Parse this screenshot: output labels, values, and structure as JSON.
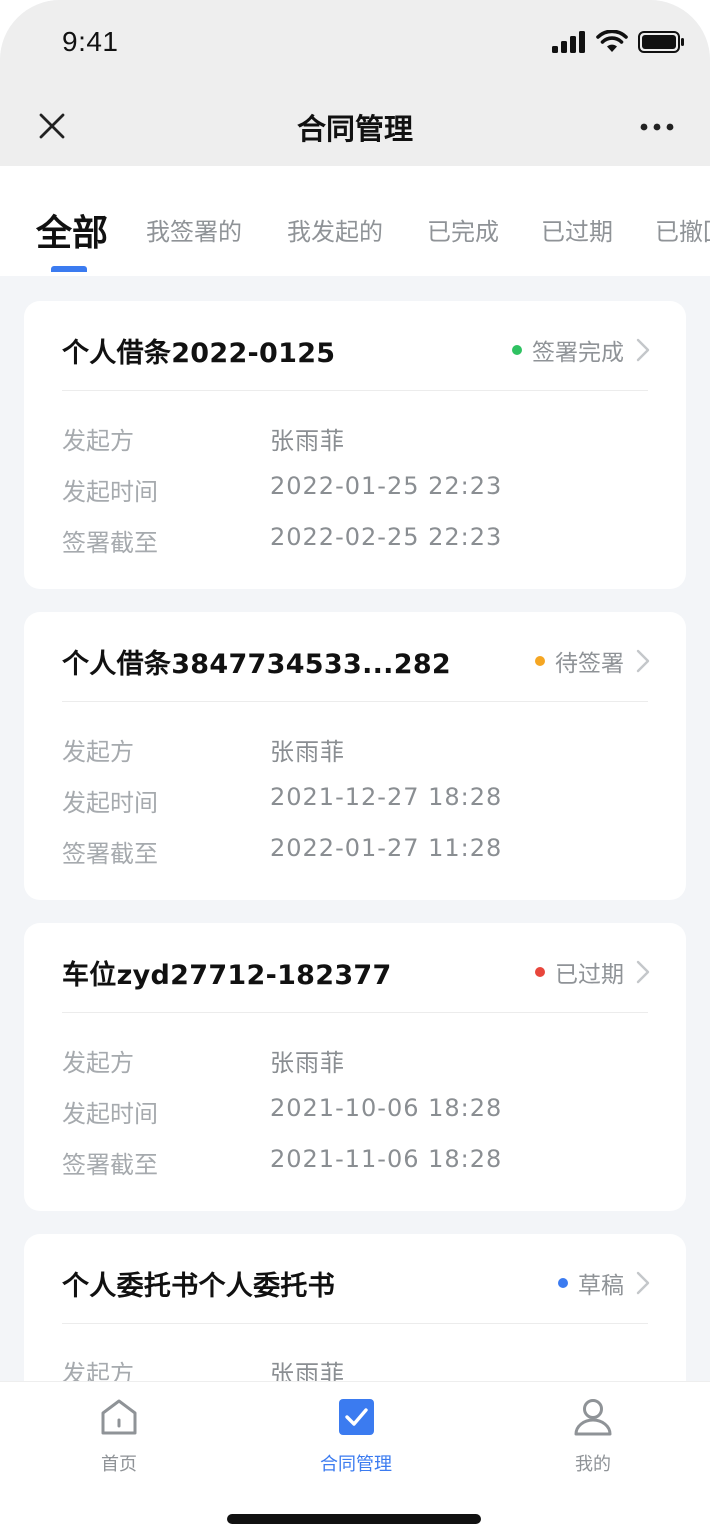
{
  "status_bar": {
    "time": "9:41"
  },
  "nav": {
    "title": "合同管理"
  },
  "tabs": [
    {
      "label": "全部",
      "active": true
    },
    {
      "label": "我签署的",
      "active": false
    },
    {
      "label": "我发起的",
      "active": false
    },
    {
      "label": "已完成",
      "active": false
    },
    {
      "label": "已过期",
      "active": false
    },
    {
      "label": "已撤回",
      "active": false
    }
  ],
  "contracts": [
    {
      "title": "个人借条2022-0125",
      "status": "签署完成",
      "status_color": "#2fc262",
      "initiator_label": "发起方",
      "initiator": "张雨菲",
      "start_label": "发起时间",
      "start_time": "2022-01-25 22:23",
      "deadline_label": "签署截至",
      "deadline": "2022-02-25 22:23"
    },
    {
      "title": "个人借条3847734533...282",
      "status": "待签署",
      "status_color": "#f5a623",
      "initiator_label": "发起方",
      "initiator": "张雨菲",
      "start_label": "发起时间",
      "start_time": "2021-12-27 18:28",
      "deadline_label": "签署截至",
      "deadline": "2022-01-27 11:28"
    },
    {
      "title": "车位zyd27712-182377",
      "status": "已过期",
      "status_color": "#e8463c",
      "initiator_label": "发起方",
      "initiator": "张雨菲",
      "start_label": "发起时间",
      "start_time": "2021-10-06 18:28",
      "deadline_label": "签署截至",
      "deadline": "2021-11-06 18:28"
    },
    {
      "title": "个人委托书个人委托书",
      "status": "草稿",
      "status_color": "#3b7bf0",
      "initiator_label": "发起方",
      "initiator": "张雨菲"
    }
  ],
  "tabbar": [
    {
      "label": "首页",
      "icon": "home-icon",
      "active": false
    },
    {
      "label": "合同管理",
      "icon": "contract-icon",
      "active": true
    },
    {
      "label": "我的",
      "icon": "user-icon",
      "active": false
    }
  ],
  "colors": {
    "accent": "#3b7bf0"
  }
}
